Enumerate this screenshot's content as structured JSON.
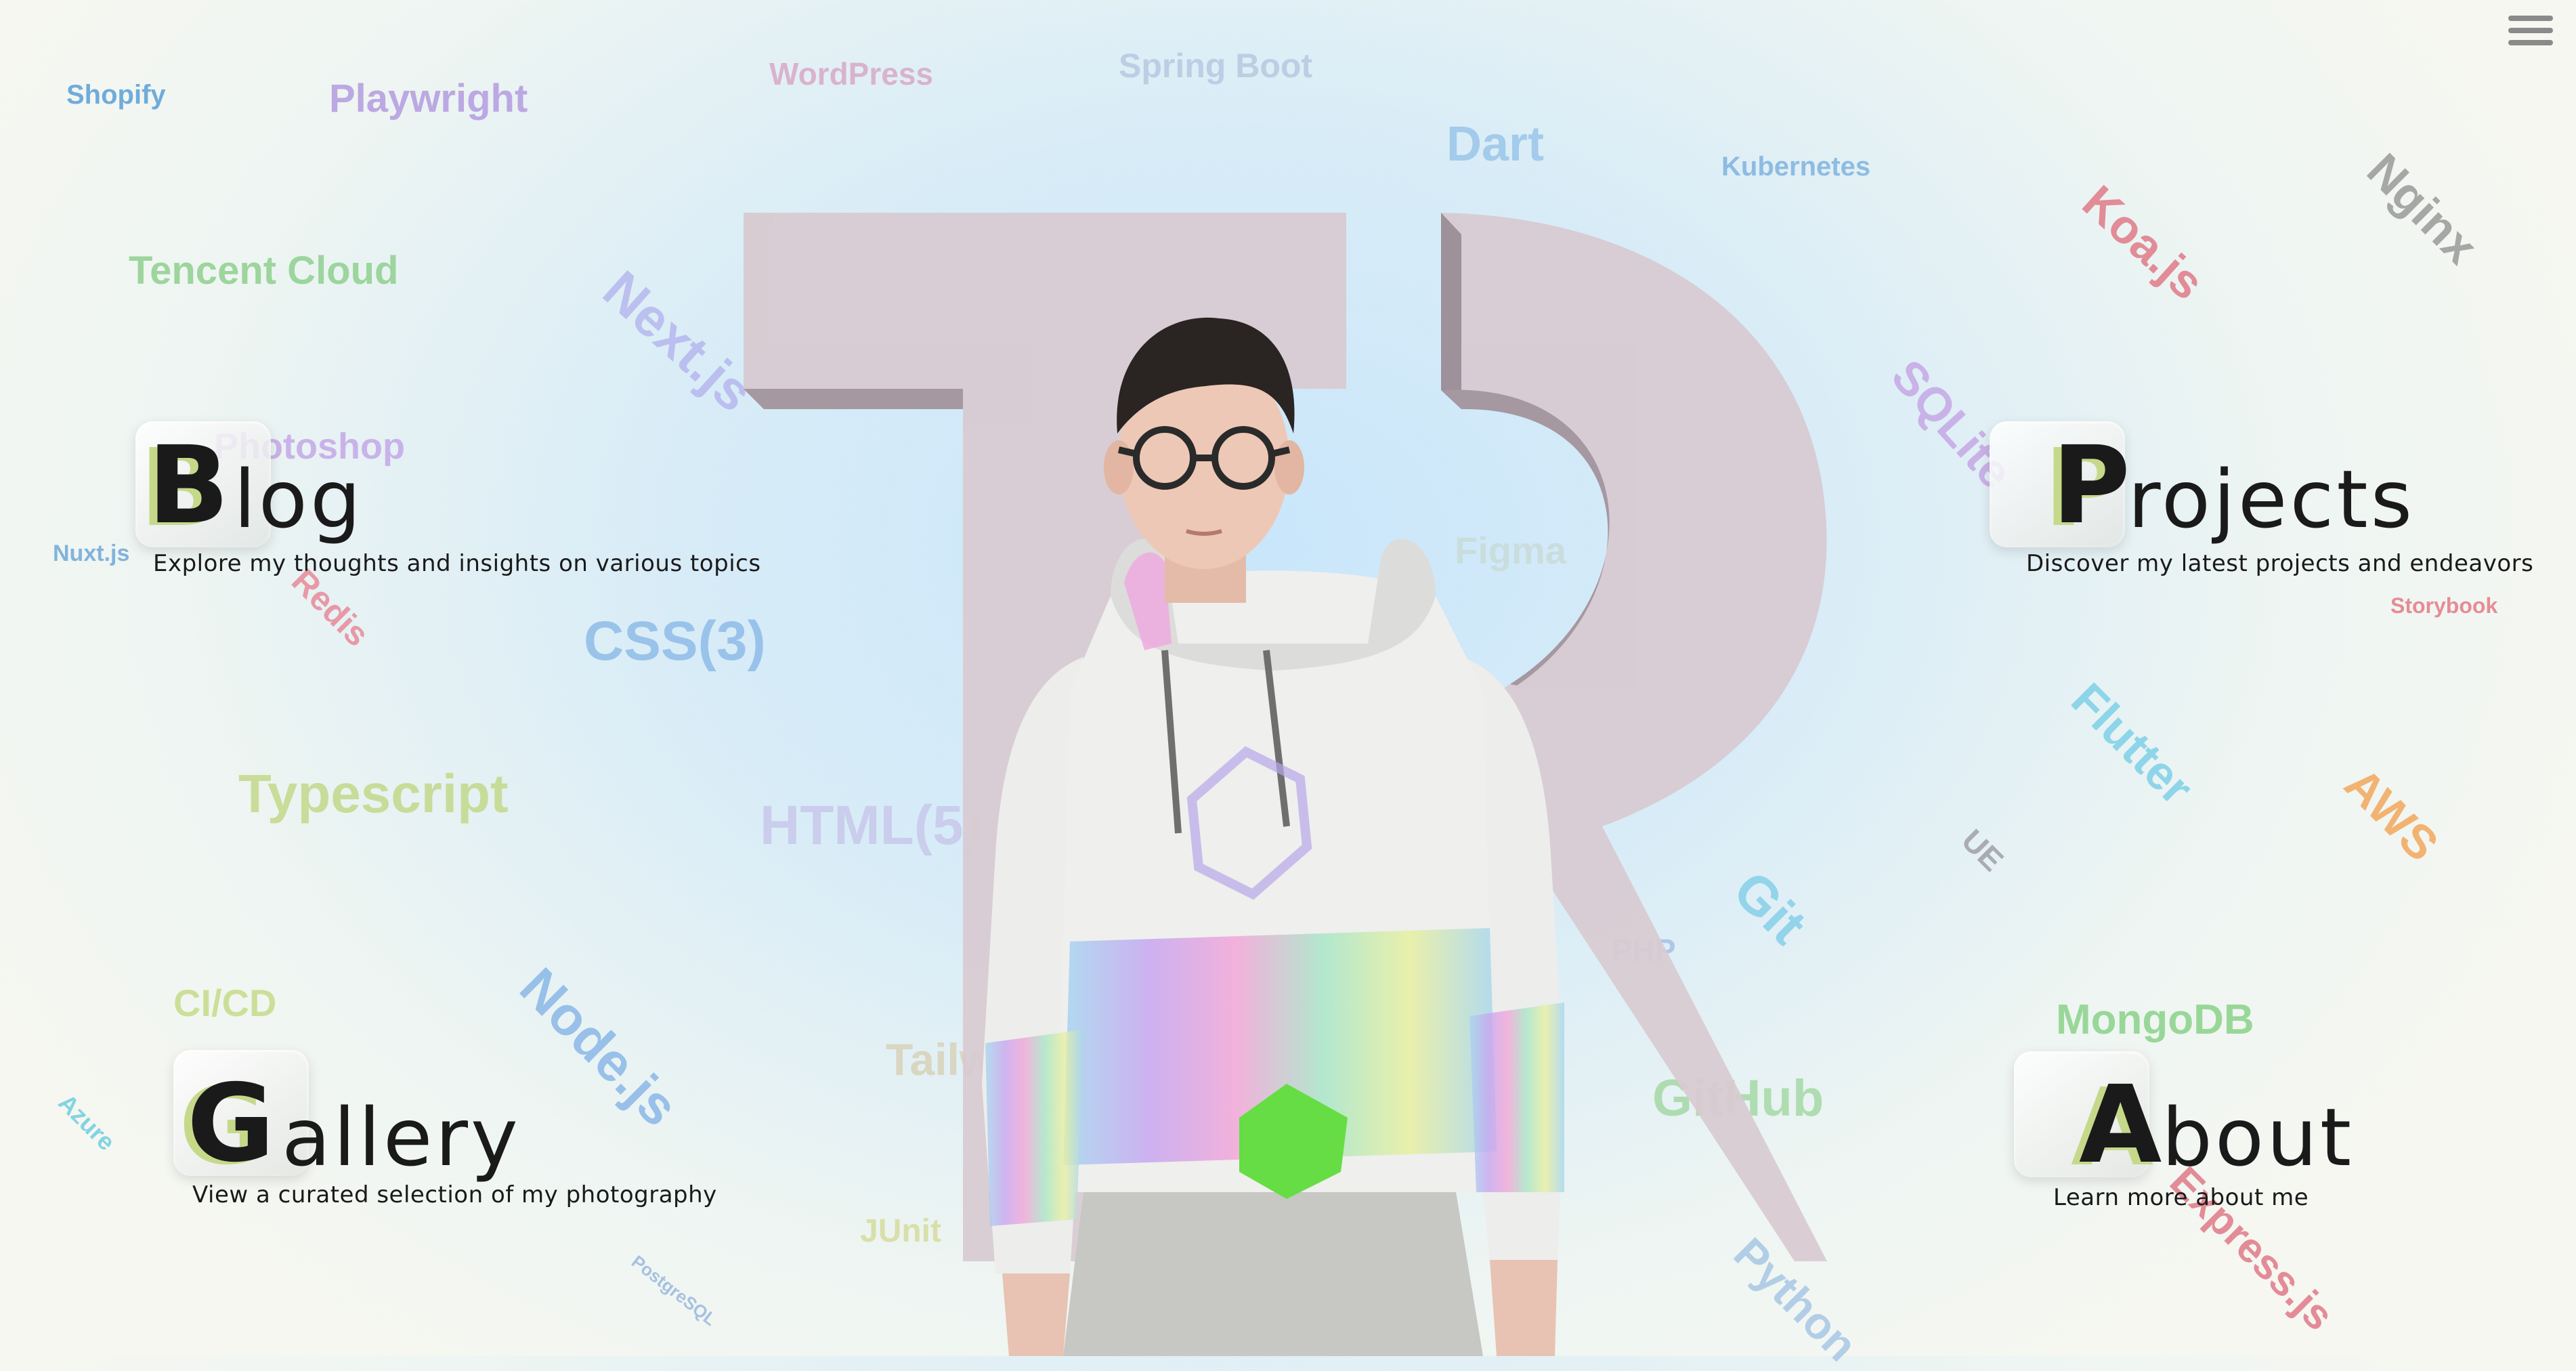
{
  "background_tags": [
    {
      "text": "Shopify",
      "color": "#5aa0d6"
    },
    {
      "text": "Playwright",
      "color": "#b49be0"
    },
    {
      "text": "WordPress",
      "color": "#d8a8c8"
    },
    {
      "text": "Spring Boot",
      "color": "#b8c8e0"
    },
    {
      "text": "Dart",
      "color": "#9ac6ea"
    },
    {
      "text": "Kubernetes",
      "color": "#7fb3e0"
    },
    {
      "text": "Koa.js",
      "color": "#e07a88"
    },
    {
      "text": "Nginx",
      "color": "#9a9a9a"
    },
    {
      "text": "Tencent Cloud",
      "color": "#8fd08f"
    },
    {
      "text": "Next.js",
      "color": "#b6b8ee"
    },
    {
      "text": "Photoshop",
      "color": "#c5a8e8"
    },
    {
      "text": "SQLite",
      "color": "#c6a8e6"
    },
    {
      "text": "Nuxt.js",
      "color": "#6fa8d8"
    },
    {
      "text": "Redis",
      "color": "#e88a98"
    },
    {
      "text": "CSS(3)",
      "color": "#8fbce8"
    },
    {
      "text": "Storybook",
      "color": "#e47a86"
    },
    {
      "text": "Typescript",
      "color": "#c3d98a"
    },
    {
      "text": "HTML(5)",
      "color": "#c8c8ea"
    },
    {
      "text": "Flutter",
      "color": "#7ed0e8"
    },
    {
      "text": "AWS",
      "color": "#f3a85c"
    },
    {
      "text": "UE",
      "color": "#a0a0a8"
    },
    {
      "text": "Git",
      "color": "#86d0ea"
    },
    {
      "text": "CI/CD",
      "color": "#c6dc8a"
    },
    {
      "text": "Node.js",
      "color": "#8ab8e8"
    },
    {
      "text": "MongoDB",
      "color": "#8ad28a"
    },
    {
      "text": "Azure",
      "color": "#6fcfe0"
    },
    {
      "text": "JUnit",
      "color": "#d6dc9c"
    },
    {
      "text": "PostgreSQL",
      "color": "#9ab8e0"
    },
    {
      "text": "Express.js",
      "color": "#e07a88"
    },
    {
      "text": "Tailwind",
      "color": "#d8d2b8"
    },
    {
      "text": "GitHub",
      "color": "#a6d8a6"
    },
    {
      "text": "Python",
      "color": "#a8c8e6"
    },
    {
      "text": "PHP",
      "color": "#a8c0e6"
    },
    {
      "text": "Figma",
      "color": "#c8dcd8"
    }
  ],
  "hero": {
    "logo_letters": "TR",
    "colors": {
      "letter_face": "#d8cbd2",
      "letter_side": "#9c8d96"
    }
  },
  "menu": {
    "icon": "hamburger-menu-icon"
  },
  "cards": {
    "blog": {
      "letter": "B",
      "rest": "log",
      "description": "Explore my thoughts and insights on various topics"
    },
    "projects": {
      "letter": "P",
      "rest": "rojects",
      "description": "Discover my latest projects and endeavors"
    },
    "gallery": {
      "letter": "G",
      "rest": "allery",
      "description": "View a curated selection of my photography"
    },
    "about": {
      "letter": "A",
      "rest": "bout",
      "description": "Learn more about me"
    }
  }
}
